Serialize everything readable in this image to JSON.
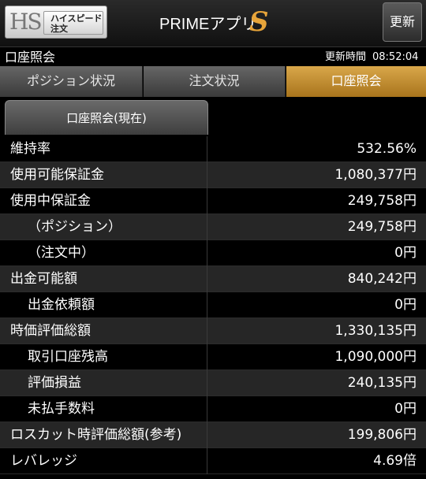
{
  "header": {
    "logo_hs": "HS",
    "logo_sub_line1": "ハイスピード",
    "logo_sub_line2": "注文",
    "app_title": "PRIMEアプリ",
    "app_title_accent": "S",
    "refresh_label": "更新"
  },
  "subheader": {
    "title": "口座照会",
    "update_label": "更新時間",
    "update_time": "08:52:04"
  },
  "tabs": [
    {
      "label": "ポジション状況",
      "active": false
    },
    {
      "label": "注文状況",
      "active": false
    },
    {
      "label": "口座照会",
      "active": true
    }
  ],
  "subtab": {
    "label": "口座照会(現在)"
  },
  "rows": [
    {
      "label": "維持率",
      "value": "532.56%"
    },
    {
      "label": "使用可能保証金",
      "value": "1,080,377円"
    },
    {
      "label": "使用中保証金",
      "value": "249,758円"
    },
    {
      "label": "（ポジション）",
      "value": "249,758円"
    },
    {
      "label": "（注文中）",
      "value": "0円"
    },
    {
      "label": "出金可能額",
      "value": "840,242円"
    },
    {
      "label": "出金依頼額",
      "value": "0円"
    },
    {
      "label": "時価評価総額",
      "value": "1,330,135円"
    },
    {
      "label": "取引口座残高",
      "value": "1,090,000円"
    },
    {
      "label": "評価損益",
      "value": "240,135円"
    },
    {
      "label": "未払手数料",
      "value": "0円"
    },
    {
      "label": "ロスカット時評価総額(参考)",
      "value": "199,806円"
    },
    {
      "label": "レバレッジ",
      "value": "4.69倍"
    }
  ],
  "colors": {
    "accent_tab": "#c08a2e",
    "logo_accent": "#e6b024",
    "title_accent": "#e8a53a"
  }
}
